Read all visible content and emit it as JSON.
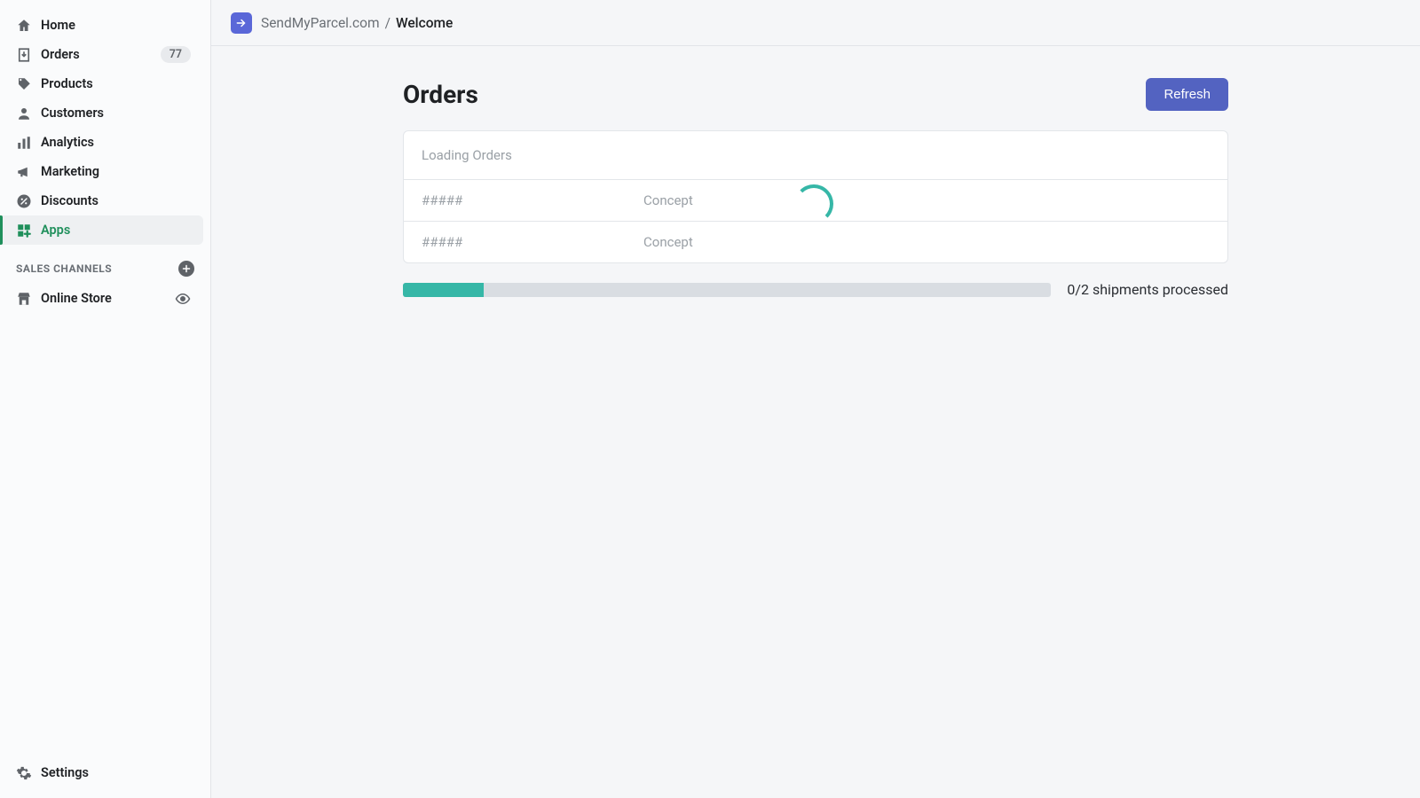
{
  "sidebar": {
    "items": [
      {
        "label": "Home",
        "icon": "home",
        "badge": null
      },
      {
        "label": "Orders",
        "icon": "orders",
        "badge": "77"
      },
      {
        "label": "Products",
        "icon": "tag",
        "badge": null
      },
      {
        "label": "Customers",
        "icon": "user",
        "badge": null
      },
      {
        "label": "Analytics",
        "icon": "analytics",
        "badge": null
      },
      {
        "label": "Marketing",
        "icon": "megaphone",
        "badge": null
      },
      {
        "label": "Discounts",
        "icon": "discount",
        "badge": null
      },
      {
        "label": "Apps",
        "icon": "apps",
        "badge": null,
        "active": true
      }
    ],
    "section_title": "SALES CHANNELS",
    "channel": {
      "label": "Online Store"
    },
    "settings": {
      "label": "Settings"
    }
  },
  "breadcrumb": {
    "app": "SendMyParcel.com",
    "sep": "/",
    "current": "Welcome"
  },
  "page": {
    "title": "Orders",
    "refresh": "Refresh"
  },
  "orders": {
    "loading": "Loading Orders",
    "rows": [
      {
        "id": "#####",
        "status": "Concept"
      },
      {
        "id": "#####",
        "status": "Concept"
      }
    ]
  },
  "progress": {
    "text": "0/2 shipments processed",
    "percent": 12.5
  }
}
